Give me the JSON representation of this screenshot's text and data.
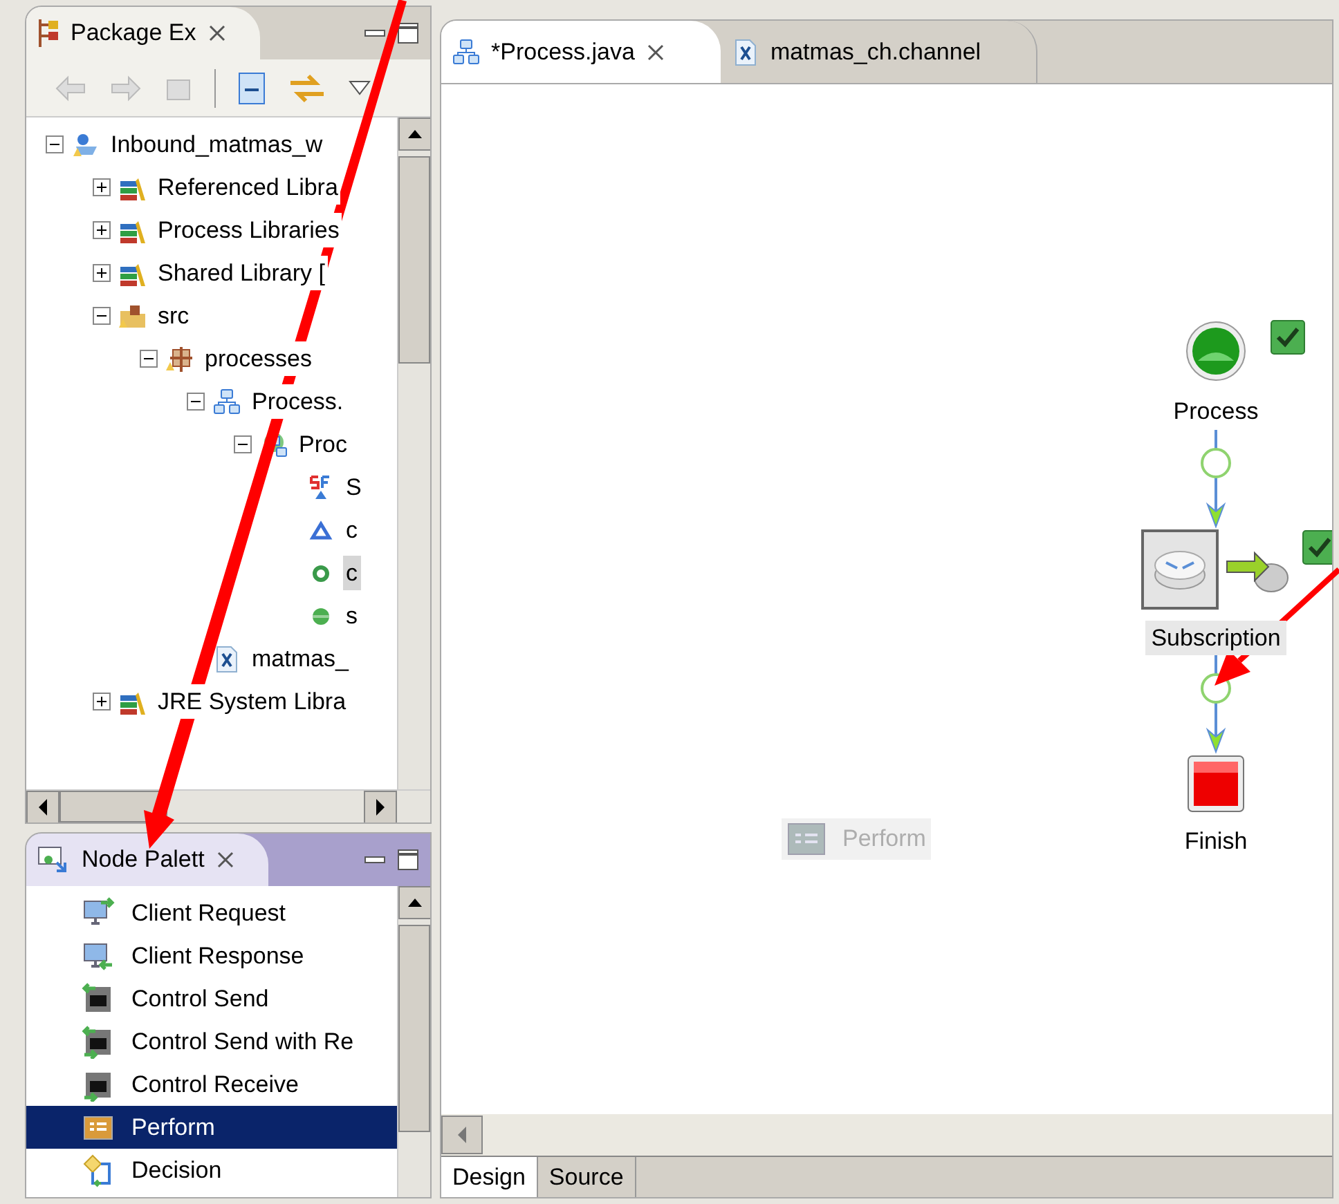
{
  "package_explorer": {
    "tab": {
      "title": "Package Ex",
      "selected": true
    },
    "tree": [
      {
        "label": "Inbound_matmas_w",
        "kind": "project",
        "expanded": true,
        "selected": false,
        "children": [
          {
            "label": "Referenced Libra",
            "kind": "library",
            "expanded": false,
            "selected": false
          },
          {
            "label": "Process Libraries",
            "kind": "library",
            "expanded": false,
            "selected": false
          },
          {
            "label": "Shared Library [",
            "kind": "library",
            "expanded": false,
            "selected": false
          },
          {
            "label": "src",
            "kind": "source-folder",
            "expanded": true,
            "selected": false,
            "children": [
              {
                "label": "processes",
                "kind": "package",
                "expanded": true,
                "selected": false,
                "children": [
                  {
                    "label": "Process.",
                    "kind": "process",
                    "expanded": true,
                    "selected": false,
                    "children": [
                      {
                        "label": "Proc",
                        "kind": "process-model",
                        "expanded": true,
                        "selected": false,
                        "children": [
                          {
                            "label": "S",
                            "kind": "symbol",
                            "selected": false
                          },
                          {
                            "label": "c",
                            "kind": "triangle",
                            "selected": false
                          },
                          {
                            "label": "c",
                            "kind": "ring",
                            "selected": true
                          },
                          {
                            "label": "s",
                            "kind": "dot",
                            "selected": false
                          }
                        ]
                      }
                    ]
                  },
                  {
                    "label": "matmas_",
                    "kind": "xml-file",
                    "selected": false
                  }
                ]
              }
            ]
          },
          {
            "label": "JRE System Libra",
            "kind": "library",
            "expanded": false,
            "selected": false
          }
        ]
      }
    ]
  },
  "node_palette": {
    "tab": {
      "title": "Node Palett",
      "selected": true
    },
    "items": [
      {
        "label": "Client Request",
        "kind": "client-request",
        "selected": false
      },
      {
        "label": "Client Response",
        "kind": "client-response",
        "selected": false
      },
      {
        "label": "Control Send",
        "kind": "control-send",
        "selected": false
      },
      {
        "label": "Control Send with Re",
        "kind": "control-send-reply",
        "selected": false
      },
      {
        "label": "Control Receive",
        "kind": "control-receive",
        "selected": false
      },
      {
        "label": "Perform",
        "kind": "perform",
        "selected": true
      },
      {
        "label": "Decision",
        "kind": "decision",
        "selected": false
      }
    ]
  },
  "editor": {
    "tabs": [
      {
        "label": "*Process.java",
        "kind": "process",
        "selected": true
      },
      {
        "label": "matmas_ch.channel",
        "kind": "xml-file",
        "selected": false
      }
    ],
    "nodes": [
      {
        "label": "Process",
        "kind": "start",
        "checked": true
      },
      {
        "label": "Subscription",
        "kind": "subscription",
        "checked": true
      },
      {
        "label": "Finish",
        "kind": "finish",
        "checked": false
      }
    ],
    "dragged_node": {
      "label": "Perform"
    },
    "bottom_tabs": [
      {
        "label": "Design",
        "selected": true
      },
      {
        "label": "Source",
        "selected": false
      }
    ]
  }
}
